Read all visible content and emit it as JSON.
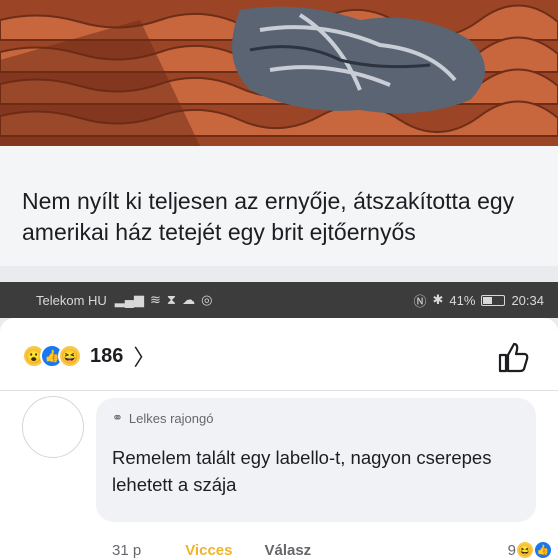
{
  "post": {
    "headline": "Nem nyílt ki teljesen az ernyője, átszakította egy amerikai ház tetejét egy brit ejtőernyős"
  },
  "statusbar": {
    "carrier": "Telekom HU",
    "battery": "41%",
    "time": "20:34"
  },
  "reactions": {
    "count": "186",
    "icons": [
      "wow-icon",
      "like-icon",
      "haha-icon"
    ]
  },
  "comment": {
    "badge": "Lelkes rajongó",
    "text": "Remelem talált egy  labello-t, nagyon cserepes lehetett a szája",
    "time": "31 p",
    "reaction_label": "Vicces",
    "reply_label": "Válasz",
    "reaction_count": "9"
  },
  "colors": {
    "accent": "#1877f2",
    "vicces": "#f0b429",
    "statusbar": "#3c3c3c"
  }
}
